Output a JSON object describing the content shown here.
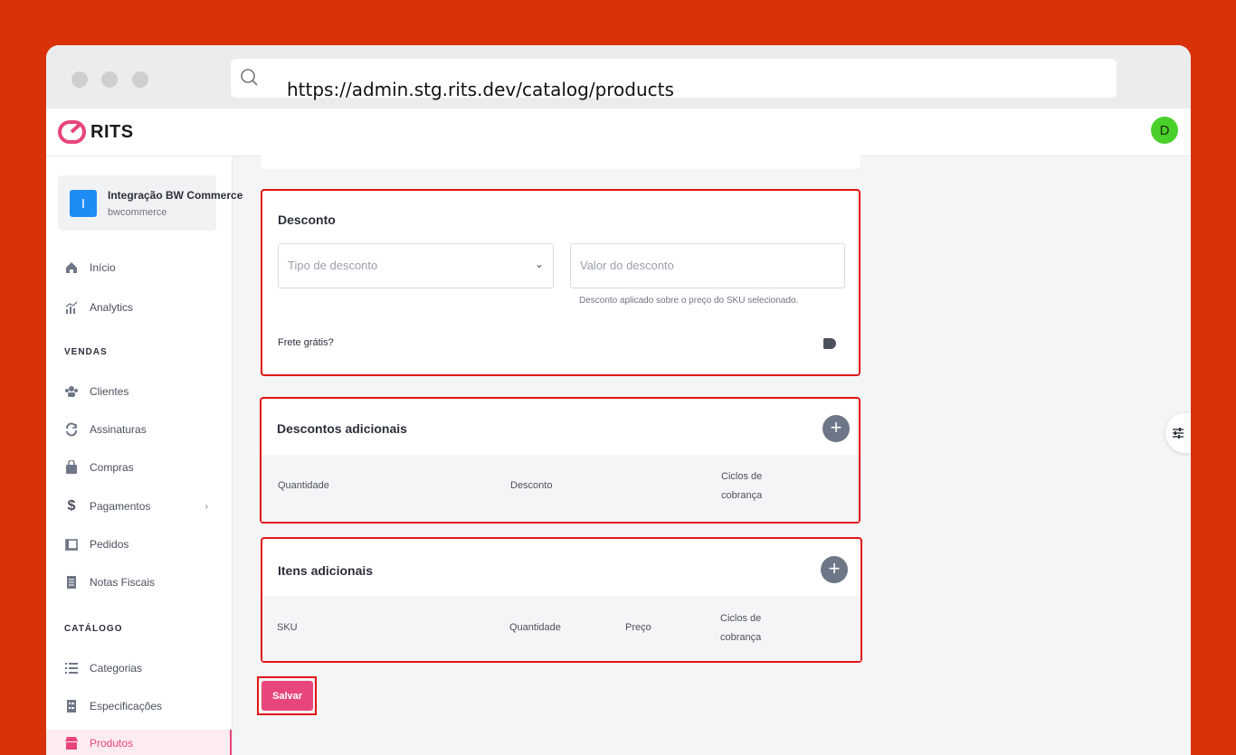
{
  "browser": {
    "url": "https://admin.stg.rits.dev/catalog/products"
  },
  "topbar": {
    "logo_text": "RITS",
    "avatar_initial": "D"
  },
  "store": {
    "badge": "I",
    "name": "Integração BW Commerce",
    "handle": "bwcommerce"
  },
  "sidebar": {
    "items": [
      {
        "label": "Início",
        "icon": "home-icon"
      },
      {
        "label": "Analytics",
        "icon": "analytics-icon"
      }
    ],
    "sections": [
      {
        "title": "VENDAS",
        "items": [
          {
            "label": "Clientes",
            "icon": "users-icon"
          },
          {
            "label": "Assinaturas",
            "icon": "refresh-icon"
          },
          {
            "label": "Compras",
            "icon": "shopping-bag-icon"
          },
          {
            "label": "Pagamentos",
            "icon": "dollar-icon",
            "chevron": "›"
          },
          {
            "label": "Pedidos",
            "icon": "orders-icon"
          },
          {
            "label": "Notas Fiscais",
            "icon": "receipt-icon"
          }
        ]
      },
      {
        "title": "CATÁLOGO",
        "items": [
          {
            "label": "Categorias",
            "icon": "list-icon"
          },
          {
            "label": "Especificações",
            "icon": "checklist-icon"
          },
          {
            "label": "Produtos",
            "icon": "store-icon",
            "active": true
          }
        ]
      }
    ]
  },
  "desconto": {
    "title": "Desconto",
    "tipo_placeholder": "Tipo de desconto",
    "valor_placeholder": "Valor do desconto",
    "help": "Desconto aplicado sobre o preço do SKU selecionado.",
    "frete_label": "Frete grátis?"
  },
  "descontos_adicionais": {
    "title": "Descontos adicionais",
    "add": "+",
    "columns": [
      "Quantidade",
      "Desconto",
      "Ciclos de cobrança"
    ]
  },
  "itens_adicionais": {
    "title": "Itens adicionais",
    "add": "+",
    "columns": [
      "SKU",
      "Quantidade",
      "Preço",
      "Ciclos de cobrança"
    ]
  },
  "actions": {
    "save_label": "Salvar"
  },
  "colors": {
    "background": "#d93109",
    "accent": "#e8457d",
    "highlight": "#e01515",
    "avatar": "#4ad02a",
    "store_badge": "#1f8bf5"
  }
}
